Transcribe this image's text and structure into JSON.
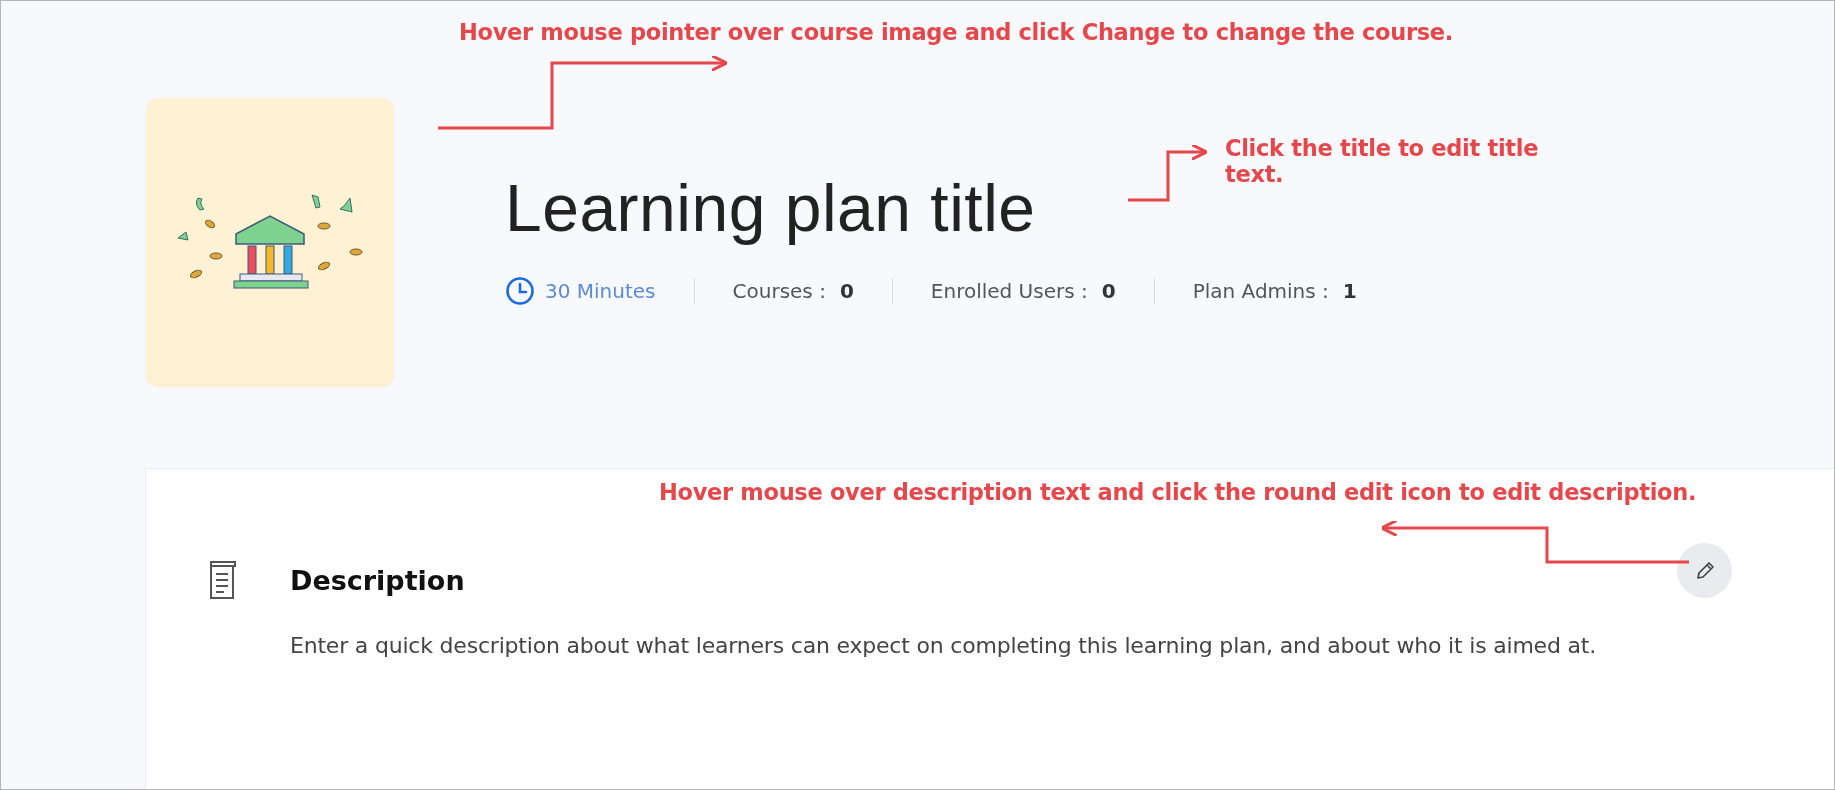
{
  "callouts": [
    {
      "text": "Hover mouse pointer over course image and click Change to change the course."
    },
    {
      "text": "Click the title to edit title text."
    },
    {
      "text": "Hover mouse over description text and click the round edit icon to edit description."
    }
  ],
  "header": {
    "title": "Learning plan title",
    "duration": "30 Minutes",
    "stats": [
      {
        "label": "Courses :",
        "value": "0"
      },
      {
        "label": "Enrolled Users :",
        "value": "0"
      },
      {
        "label": "Plan Admins :",
        "value": "1"
      }
    ]
  },
  "description": {
    "heading": "Description",
    "text": "Enter a quick description about what learners can expect on completing this learning plan, and about who it is aimed at."
  }
}
